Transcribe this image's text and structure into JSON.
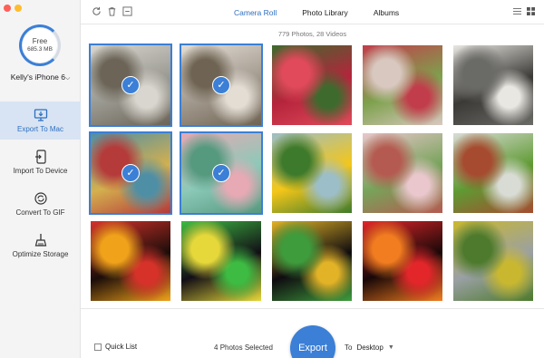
{
  "sidebar": {
    "storage_label": "Free",
    "storage_value": "685.3 MB",
    "storage_free_fraction": 0.95,
    "device_name": "Kelly's iPhone 6",
    "items": [
      {
        "label": "Export To Mac",
        "icon": "monitor-icon",
        "active": true
      },
      {
        "label": "Import To Device",
        "icon": "phone-import-icon",
        "active": false
      },
      {
        "label": "Convert To GIF",
        "icon": "convert-icon",
        "active": false
      },
      {
        "label": "Optimize Storage",
        "icon": "broom-icon",
        "active": false
      }
    ]
  },
  "toolbar": {
    "icons": [
      "refresh-icon",
      "trash-icon",
      "minus-icon"
    ],
    "tabs": [
      {
        "label": "Camera Roll",
        "active": true
      },
      {
        "label": "Photo Library",
        "active": false
      },
      {
        "label": "Albums",
        "active": false
      }
    ],
    "view_icons": [
      "list-view-icon",
      "grid-view-icon"
    ]
  },
  "summary": "779 Photos, 28 Videos",
  "photos": [
    {
      "selected": true,
      "palette": [
        "#9b9a92",
        "#d9d6cf",
        "#6b6457"
      ]
    },
    {
      "selected": true,
      "palette": [
        "#a39a8f",
        "#e3ddd4",
        "#6f6453"
      ]
    },
    {
      "selected": false,
      "palette": [
        "#b5243c",
        "#3f6a2e",
        "#e04a5a"
      ]
    },
    {
      "selected": false,
      "palette": [
        "#7ea14d",
        "#c23d4b",
        "#d9c8c0"
      ]
    },
    {
      "selected": false,
      "palette": [
        "#3c3a36",
        "#e9e7e2",
        "#6a6a66"
      ]
    },
    {
      "selected": true,
      "palette": [
        "#d4b04e",
        "#4f8fa6",
        "#b53a3a"
      ]
    },
    {
      "selected": true,
      "palette": [
        "#8cc9b8",
        "#e7a9b4",
        "#55997f"
      ]
    },
    {
      "selected": false,
      "palette": [
        "#f4c619",
        "#9cbec8",
        "#3e7a2c"
      ]
    },
    {
      "selected": false,
      "palette": [
        "#77a35a",
        "#e9c7cc",
        "#b55a50"
      ]
    },
    {
      "selected": false,
      "palette": [
        "#5f9a33",
        "#d9dcd5",
        "#a64b2f"
      ]
    },
    {
      "selected": false,
      "palette": [
        "#1b0d0a",
        "#d6322a",
        "#f0a21a"
      ]
    },
    {
      "selected": false,
      "palette": [
        "#120e16",
        "#3dbb42",
        "#e6d83a"
      ]
    },
    {
      "selected": false,
      "palette": [
        "#0f0c10",
        "#e2b227",
        "#3e9c3d"
      ]
    },
    {
      "selected": false,
      "palette": [
        "#180808",
        "#e2262a",
        "#f27d20"
      ]
    },
    {
      "selected": false,
      "palette": [
        "#9aa0a4",
        "#c9b82f",
        "#4d7a2c"
      ]
    }
  ],
  "bottom": {
    "quick_list_label": "Quick List",
    "selected_count": "4",
    "selected_text": "Photos Selected",
    "export_label": "Export",
    "to_label": "To",
    "destination": "Desktop"
  },
  "colors": {
    "accent": "#3b7fd6",
    "sidebar_bg": "#f4f4f5",
    "active_nav_bg": "#d8e4f3"
  }
}
